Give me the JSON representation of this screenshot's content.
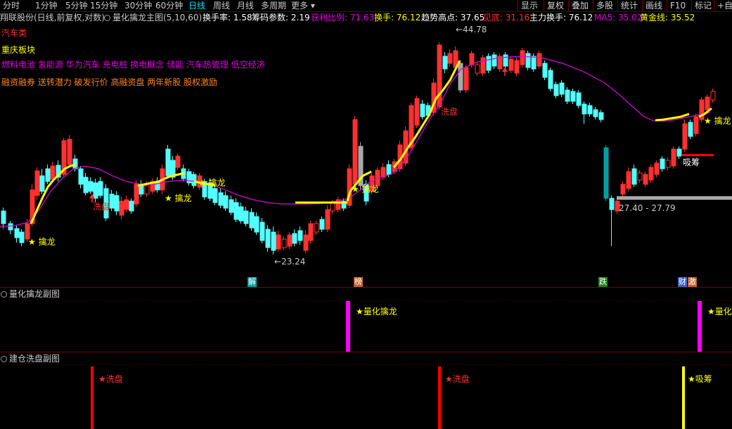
{
  "tabs": [
    {
      "label": "分时",
      "active": false
    },
    {
      "label": "1分钟",
      "active": false
    },
    {
      "label": "5分钟",
      "active": false
    },
    {
      "label": "15分钟",
      "active": false
    },
    {
      "label": "30分钟",
      "active": false
    },
    {
      "label": "60分钟",
      "active": false
    },
    {
      "label": "日线",
      "active": true
    },
    {
      "label": "周线",
      "active": false
    },
    {
      "label": "月线",
      "active": false
    },
    {
      "label": "多周期",
      "active": false
    },
    {
      "label": "更多",
      "active": false
    }
  ],
  "tools": [
    "显示",
    "复权",
    "叠加",
    "多股",
    "统计",
    "画线",
    "F10",
    "标记",
    "+自选"
  ],
  "info": {
    "stock_title": "翔联股份(日线,前复权,对数)",
    "indicator_name": "量化擒龙主图(5,10,60)",
    "turnover_label": "换手率:",
    "turnover_value": "1.58",
    "chip_label": "筹码参数:",
    "chip_value": "2.19",
    "profit_label": "获利比例:",
    "profit_value": "71.63",
    "hand_label": "换手:",
    "hand_value": "76.12",
    "trend_high_label": "趋势高点:",
    "trend_high_value": "37.65",
    "bottom_label": "见底:",
    "bottom_value": "31.16",
    "main_hand_label": "主力换手:",
    "main_hand_value": "76.12",
    "ma5_label": "MA5:",
    "ma5_value": "35.02",
    "gold_label": "黄金线:",
    "gold_value": "35.52"
  },
  "concepts": {
    "sector": "汽车类",
    "region": "重庆板块",
    "tags1": "燃料电池 氢能源 华为汽车 充电桩 换电概念 储能 汽车热管理 低空经济",
    "tags2": "融资融券 送转潜力 破发行价 高融资盘 两年新股 股权激励"
  },
  "annotations": {
    "high_price": "44.78",
    "low_price": "23.24",
    "gap_range": "27.40 - 27.79",
    "qinlong": "擒龙",
    "xipan": "洗盘",
    "xichou": "吸筹",
    "star": "★"
  },
  "events": [
    {
      "label": "解",
      "color": "#00a0a0",
      "text_color": "#ffffff"
    },
    {
      "label": "榜",
      "color": "#c06030",
      "text_color": "#ffffff"
    },
    {
      "label": "跌",
      "color": "#208020",
      "text_color": "#ffffff"
    },
    {
      "label": "财",
      "color": "#4060c0",
      "text_color": "#ffffff"
    },
    {
      "label": "激",
      "color": "#c06030",
      "text_color": "#ffffff"
    }
  ],
  "panels": {
    "sub1_title": "量化擒龙副图",
    "sub1_label": "★量化擒龙",
    "sub1_label_cut": "★量化",
    "sub2_title": "建仓洗盘副图",
    "sub2_wash": "★洗盘",
    "sub2_absorb": "★吸筹"
  },
  "colors": {
    "up": "#ff3030",
    "down": "#54ffff",
    "dark_down": "#00a0a0",
    "gray_candle": "#a8a8a8",
    "ma_line": "#e000e0",
    "gold_line": "#ffff00",
    "magenta_bar": "#ff00ff",
    "red_bar": "#ff0000",
    "yellow_bar": "#ffff00"
  }
}
